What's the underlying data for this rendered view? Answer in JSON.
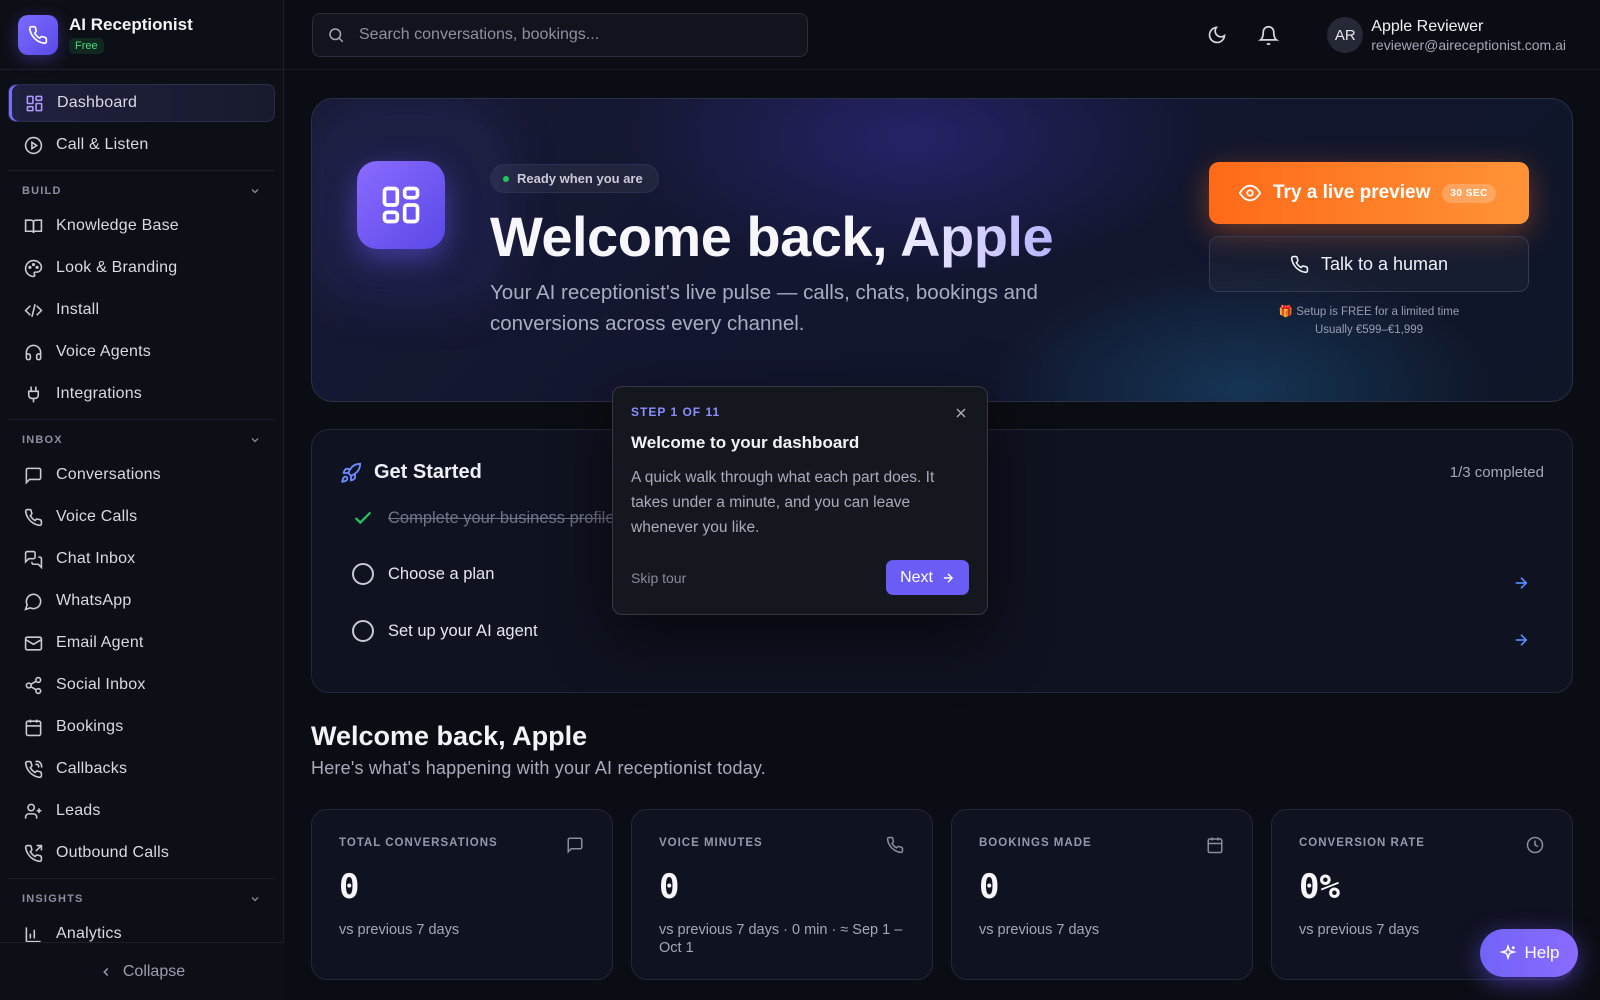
{
  "brand": {
    "name": "AI Receptionist",
    "plan_badge": "Free"
  },
  "sidebar": {
    "top_items": [
      {
        "label": "Dashboard",
        "icon": "grid-icon",
        "active": true
      },
      {
        "label": "Call & Listen",
        "icon": "play-circle-icon"
      }
    ],
    "sections": [
      {
        "title": "BUILD",
        "items": [
          {
            "label": "Knowledge Base",
            "icon": "book-icon"
          },
          {
            "label": "Look & Branding",
            "icon": "palette-icon"
          },
          {
            "label": "Install",
            "icon": "code-icon"
          },
          {
            "label": "Voice Agents",
            "icon": "headphones-icon"
          },
          {
            "label": "Integrations",
            "icon": "plug-icon"
          }
        ]
      },
      {
        "title": "INBOX",
        "items": [
          {
            "label": "Conversations",
            "icon": "message-square-icon"
          },
          {
            "label": "Voice Calls",
            "icon": "phone-icon"
          },
          {
            "label": "Chat Inbox",
            "icon": "messages-icon"
          },
          {
            "label": "WhatsApp",
            "icon": "whatsapp-icon"
          },
          {
            "label": "Email Agent",
            "icon": "mail-icon"
          },
          {
            "label": "Social Inbox",
            "icon": "share-icon"
          },
          {
            "label": "Bookings",
            "icon": "calendar-icon"
          },
          {
            "label": "Callbacks",
            "icon": "phone-callback-icon"
          },
          {
            "label": "Leads",
            "icon": "user-plus-icon"
          },
          {
            "label": "Outbound Calls",
            "icon": "phone-outgoing-icon"
          }
        ]
      },
      {
        "title": "INSIGHTS",
        "items": [
          {
            "label": "Analytics",
            "icon": "bar-chart-icon"
          }
        ]
      }
    ],
    "collapse_label": "Collapse"
  },
  "topbar": {
    "search_placeholder": "Search conversations, bookings...",
    "user": {
      "initials": "AR",
      "name": "Apple Reviewer",
      "email": "reviewer@aireceptionist.com.ai"
    }
  },
  "hero": {
    "pill": "Ready when you are",
    "title_prefix": "Welcome back, ",
    "title_name": "Apple",
    "subtitle": "Your AI receptionist's live pulse — calls, chats, bookings and conversions across every channel.",
    "preview_button": "Try a live preview",
    "preview_tag": "30 SEC",
    "human_button": "Talk to a human",
    "promo_line1": "🎁 Setup is FREE for a limited time",
    "promo_line2": "Usually €599–€1,999"
  },
  "get_started": {
    "title": "Get Started",
    "count": "1/3 completed",
    "tasks": [
      {
        "label": "Complete your business profile",
        "done": true
      },
      {
        "label": "Choose a plan",
        "done": false
      },
      {
        "label": "Set up your AI agent",
        "done": false
      }
    ]
  },
  "tour": {
    "step": "STEP 1 OF 11",
    "title": "Welcome to your dashboard",
    "body": "A quick walk through what each part does. It takes under a minute, and you can leave whenever you like.",
    "skip": "Skip tour",
    "next": "Next"
  },
  "welcome": {
    "title": "Welcome back, Apple",
    "subtitle": "Here's what's happening with your AI receptionist today."
  },
  "stats": [
    {
      "label": "TOTAL CONVERSATIONS",
      "value": "0",
      "sub": "vs previous 7 days",
      "icon": "message-square-icon"
    },
    {
      "label": "VOICE MINUTES",
      "value": "0",
      "sub": "vs previous 7 days · 0 min · ≈ Sep 1 – Oct 1",
      "icon": "phone-icon"
    },
    {
      "label": "BOOKINGS MADE",
      "value": "0",
      "sub": "vs previous 7 days",
      "icon": "calendar-icon"
    },
    {
      "label": "CONVERSION RATE",
      "value": "0%",
      "sub": "vs previous 7 days",
      "icon": "clock-icon"
    }
  ],
  "help_label": "Help",
  "colors": {
    "accent": "#6b5cf5",
    "orange": "#ff7a22",
    "background": "#0b0d14",
    "success": "#22c55e"
  }
}
